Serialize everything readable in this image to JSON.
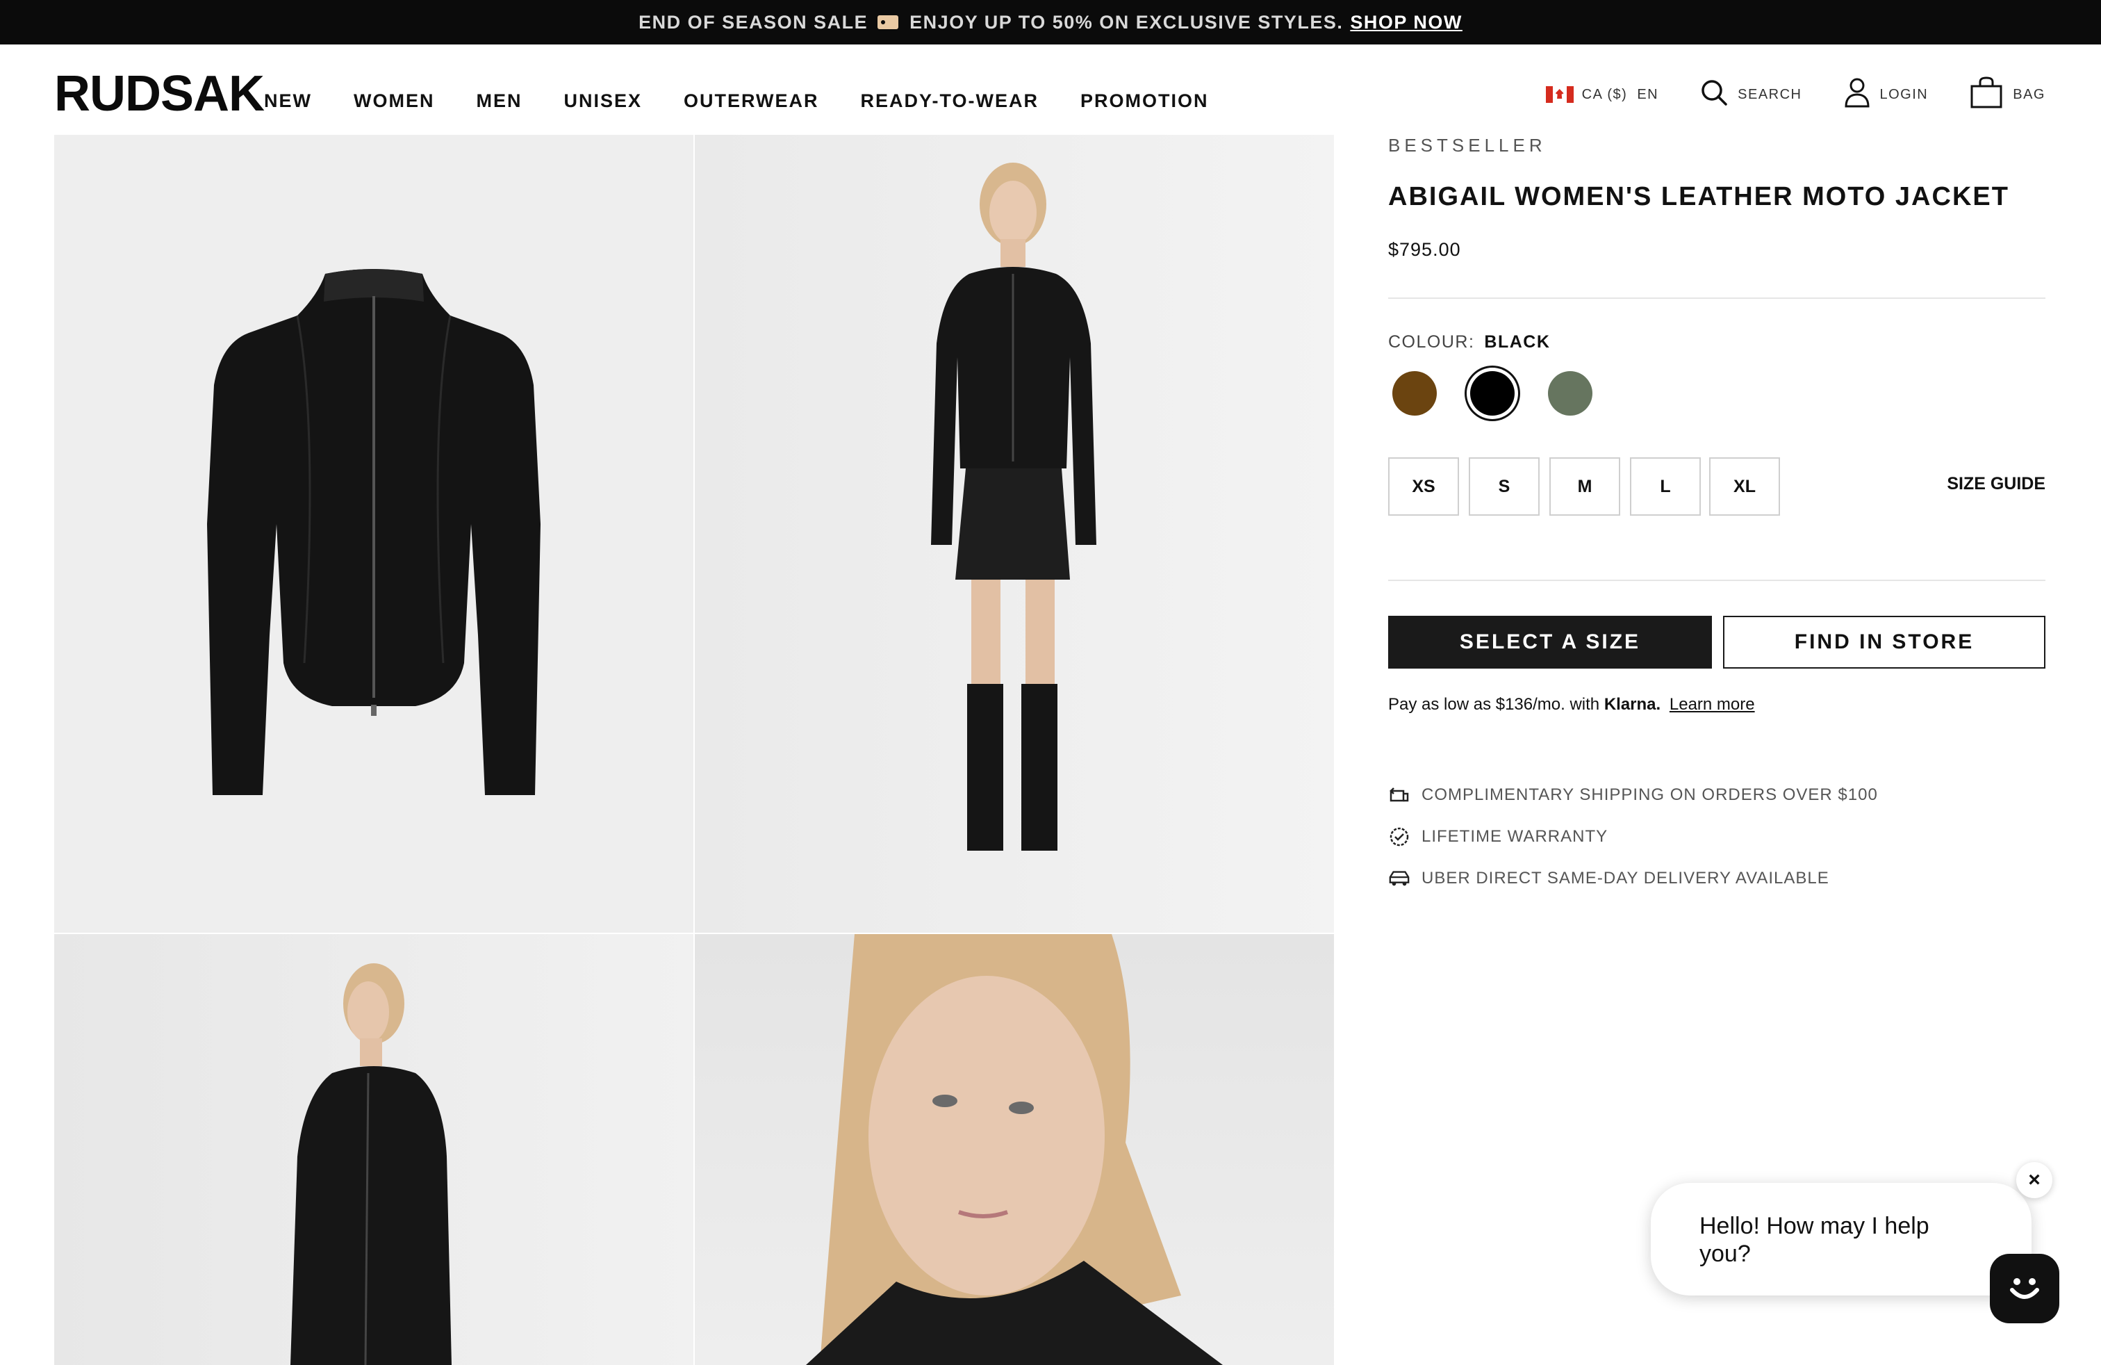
{
  "promo": {
    "text": "END OF SEASON SALE",
    "text2": "ENJOY UP TO 50% ON EXCLUSIVE STYLES.",
    "cta": "SHOP NOW"
  },
  "header": {
    "logo": "RUDSAK",
    "nav": [
      "NEW",
      "WOMEN",
      "MEN",
      "UNISEX",
      "OUTERWEAR",
      "READY-TO-WEAR",
      "PROMOTION"
    ],
    "region": "CA ($)",
    "language": "EN",
    "search": "SEARCH",
    "login": "LOGIN",
    "bag": "BAG"
  },
  "product": {
    "kicker": "BESTSELLER",
    "title": "ABIGAIL WOMEN'S LEATHER MOTO JACKET",
    "price": "$795.00",
    "colour_label": "COLOUR:",
    "colour_value": "BLACK",
    "swatches": [
      {
        "name": "brown",
        "color": "#6b4410"
      },
      {
        "name": "black",
        "color": "#000000"
      },
      {
        "name": "green",
        "color": "#66755f"
      }
    ],
    "sizes": [
      "XS",
      "S",
      "M",
      "L",
      "XL"
    ],
    "size_guide": "SIZE GUIDE",
    "select_size": "SELECT A SIZE",
    "find_in_store": "FIND IN STORE",
    "klarna_pre": "Pay as low as $136/mo. with",
    "klarna_brand": "Klarna.",
    "klarna_link": "Learn more",
    "perks": [
      {
        "icon": "shipping-icon",
        "text": "COMPLIMENTARY SHIPPING ON ORDERS OVER $100"
      },
      {
        "icon": "warranty-icon",
        "text": "LIFETIME WARRANTY"
      },
      {
        "icon": "car-icon",
        "text": "UBER DIRECT SAME-DAY DELIVERY AVAILABLE"
      }
    ]
  },
  "chat": {
    "message": "Hello! How may I help you?",
    "close": "×"
  }
}
